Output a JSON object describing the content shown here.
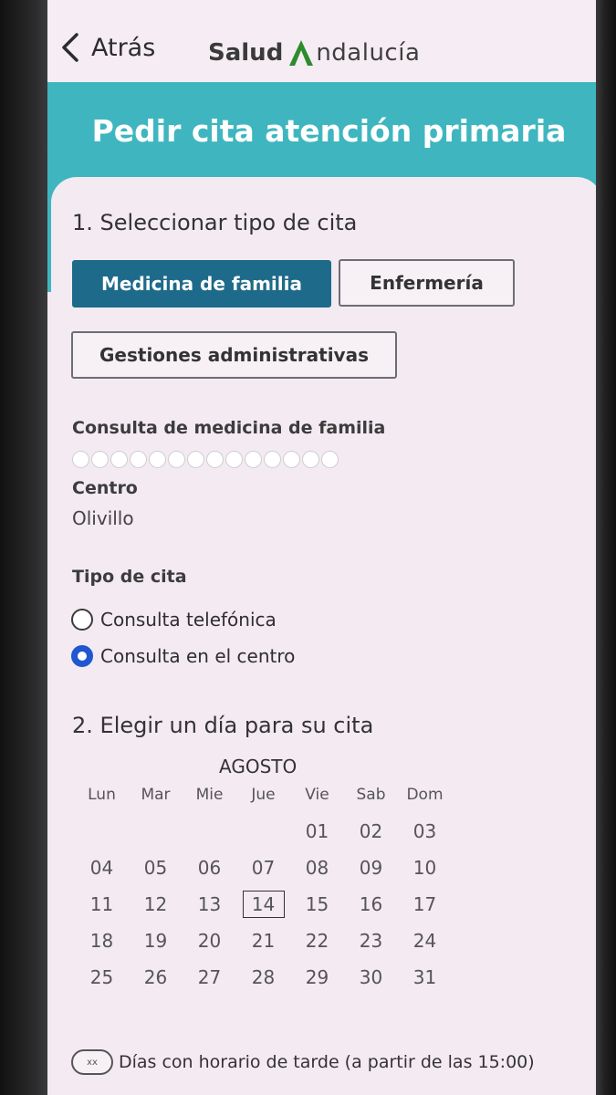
{
  "nav": {
    "back_label": "Atrás",
    "brand_part1": "Salud",
    "brand_part2": "ndalucía"
  },
  "page_title": "Pedir cita atención primaria",
  "step1": {
    "title": "1. Seleccionar tipo de cita",
    "buttons": {
      "medicina": "Medicina de familia",
      "enfermeria": "Enfermería",
      "gestiones": "Gestiones administrativas"
    },
    "selected": "Medicina de familia"
  },
  "consulta": {
    "label": "Consulta de medicina de familia"
  },
  "centro": {
    "label": "Centro",
    "value": "Olivillo"
  },
  "tipo_cita": {
    "label": "Tipo de cita",
    "options": [
      "Consulta telefónica",
      "Consulta en el centro"
    ],
    "selected": "Consulta en el centro"
  },
  "step2": {
    "title": "2. Elegir un día para su cita",
    "month": "AGOSTO",
    "weekdays": [
      "Lun",
      "Mar",
      "Mie",
      "Jue",
      "Vie",
      "Sab",
      "Dom"
    ],
    "weeks": [
      [
        "",
        "",
        "",
        "",
        "01",
        "02",
        "03"
      ],
      [
        "04",
        "05",
        "06",
        "07",
        "08",
        "09",
        "10"
      ],
      [
        "11",
        "12",
        "13",
        "14",
        "15",
        "16",
        "17"
      ],
      [
        "18",
        "19",
        "20",
        "21",
        "22",
        "23",
        "24"
      ],
      [
        "25",
        "26",
        "27",
        "28",
        "29",
        "30",
        "31"
      ]
    ],
    "today": "14"
  },
  "legend": {
    "pill": "xx",
    "text": "Días con horario de tarde (a partir de las 15:00)"
  },
  "colors": {
    "header_teal": "#3fb6bf",
    "primary_button": "#1e6a8a",
    "radio_selected": "#2156d1",
    "brand_green": "#2e8b2e"
  }
}
